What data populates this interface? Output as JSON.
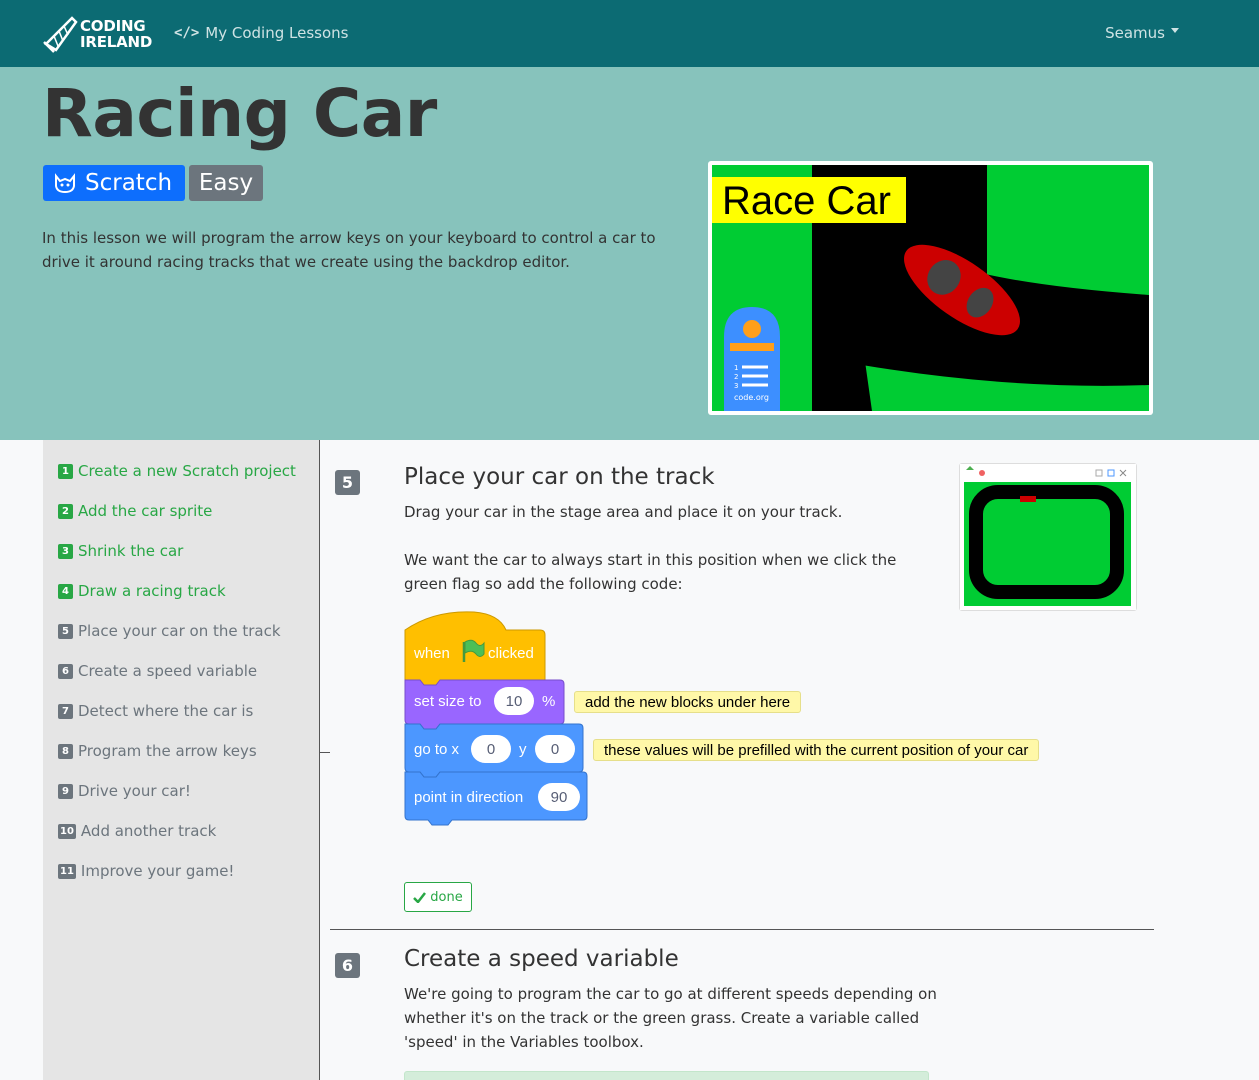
{
  "navbar": {
    "logo_line1": "CODING",
    "logo_line2": "IRELAND",
    "lessons_link": "My Coding Lessons",
    "user_name": "Seamus"
  },
  "hero": {
    "title": "Racing Car",
    "badge_platform": "Scratch",
    "badge_level": "Easy",
    "description": "In this lesson we will program the arrow keys on your keyboard to control a car to drive it around racing tracks that we create using the backdrop editor.",
    "image_title": "Race Car",
    "image_caption": "code.org"
  },
  "sidebar": {
    "items": [
      {
        "num": "1",
        "label": "Create a new Scratch project",
        "status": "done"
      },
      {
        "num": "2",
        "label": "Add the car sprite",
        "status": "done"
      },
      {
        "num": "3",
        "label": "Shrink the car",
        "status": "done"
      },
      {
        "num": "4",
        "label": "Draw a racing track",
        "status": "done"
      },
      {
        "num": "5",
        "label": "Place your car on the track",
        "status": "todo"
      },
      {
        "num": "6",
        "label": "Create a speed variable",
        "status": "todo"
      },
      {
        "num": "7",
        "label": "Detect where the car is",
        "status": "todo"
      },
      {
        "num": "8",
        "label": "Program the arrow keys",
        "status": "todo"
      },
      {
        "num": "9",
        "label": "Drive your car!",
        "status": "todo"
      },
      {
        "num": "10",
        "label": "Add another track",
        "status": "todo"
      },
      {
        "num": "11",
        "label": "Improve your game!",
        "status": "todo"
      }
    ]
  },
  "step5": {
    "num": "5",
    "title": "Place your car on the track",
    "text1": "Drag your car in the stage area and place it on your track.",
    "text2_line1": "We want the car to always start in this position when we click the",
    "text2_line2": "green flag so add the following code:",
    "blocks": {
      "when": "when",
      "clicked": "clicked",
      "set_size": "set size to",
      "size_value": "10",
      "percent": "%",
      "go_to_x": "go to x",
      "x_value": "0",
      "y": "y",
      "y_value": "0",
      "point_dir": "point in direction",
      "dir_value": "90",
      "note1": "add the new blocks under here",
      "note2": "these values will be prefilled with the current position of your car"
    },
    "done_label": "done"
  },
  "step6": {
    "num": "6",
    "title": "Create a speed variable",
    "line1": "We're going to program the car to go at different speeds depending on",
    "line2": "whether it's on the track or the green grass. Create a variable called",
    "line3": "'speed' in the Variables toolbox."
  },
  "colors": {
    "navbar": "#0c6b73",
    "hero": "#87c3bc",
    "primary": "#0d6efd",
    "secondary": "#6c757d",
    "success": "#28a745",
    "scratch_event": "#ffbf00",
    "scratch_looks": "#9966ff",
    "scratch_motion": "#4c97ff"
  }
}
